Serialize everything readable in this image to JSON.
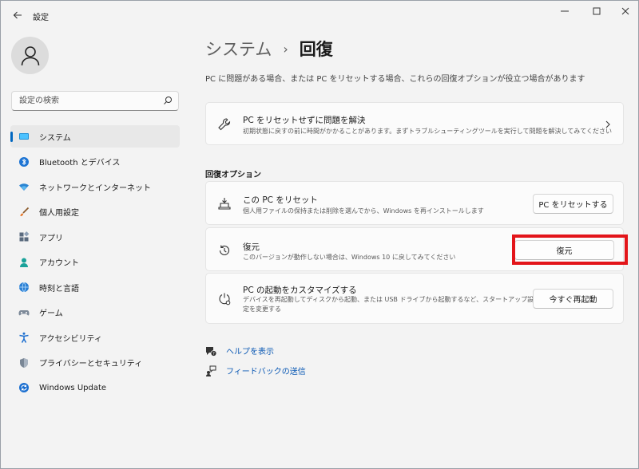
{
  "app": {
    "title": "設定"
  },
  "search": {
    "placeholder": "設定の検索"
  },
  "sidebar": {
    "items": [
      {
        "label": "システム",
        "icon": "system-icon",
        "active": true
      },
      {
        "label": "Bluetooth とデバイス",
        "icon": "bluetooth-icon"
      },
      {
        "label": "ネットワークとインターネット",
        "icon": "network-icon"
      },
      {
        "label": "個人用設定",
        "icon": "brush-icon"
      },
      {
        "label": "アプリ",
        "icon": "apps-icon"
      },
      {
        "label": "アカウント",
        "icon": "account-icon"
      },
      {
        "label": "時刻と言語",
        "icon": "time-language-icon"
      },
      {
        "label": "ゲーム",
        "icon": "gamepad-icon"
      },
      {
        "label": "アクセシビリティ",
        "icon": "accessibility-icon"
      },
      {
        "label": "プライバシーとセキュリティ",
        "icon": "shield-icon"
      },
      {
        "label": "Windows Update",
        "icon": "update-icon"
      }
    ]
  },
  "header": {
    "breadcrumb_parent": "システム",
    "breadcrumb_sep": "›",
    "breadcrumb_current": "回復",
    "subtitle": "PC に問題がある場合、または PC をリセットする場合、これらの回復オプションが役立つ場合があります"
  },
  "troubleshoot": {
    "title": "PC をリセットせずに問題を解決",
    "desc": "初期状態に戻すの前に時間がかかることがあります。まずトラブルシューティングツールを実行して問題を解決してみてください"
  },
  "recovery": {
    "section_title": "回復オプション",
    "reset": {
      "title": "この PC をリセット",
      "desc": "個人用ファイルの保持または削除を選んでから、Windows を再インストールします",
      "button": "PC をリセットする"
    },
    "goback": {
      "title": "復元",
      "desc": "このバージョンが動作しない場合は、Windows 10 に戻してみてください",
      "button": "復元"
    },
    "startup": {
      "title": "PC の起動をカスタマイズする",
      "desc1": "デバイスを再起動してディスクから起動、または USB ドライブから起動するなど、スタートアップ設",
      "desc2": "定を変更する",
      "button": "今すぐ再起動"
    }
  },
  "links": {
    "help": "ヘルプを表示",
    "feedback": "フィードバックの送信"
  },
  "colors": {
    "accent": "#0067c0",
    "highlight": "#e3151a",
    "link": "#0a58b4"
  }
}
